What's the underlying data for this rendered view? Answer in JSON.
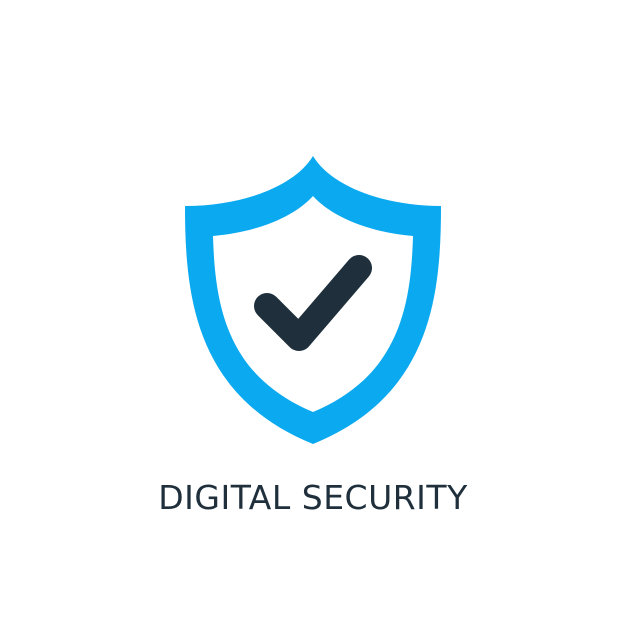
{
  "caption": {
    "text": "DIGITAL SECURITY"
  },
  "icon": {
    "name": "shield-check-icon",
    "shield_color": "#0aa9f0",
    "shield_inner_color": "#ffffff",
    "check_color": "#1f2f3b"
  },
  "colors": {
    "background": "#ffffff",
    "text": "#1f2f3b"
  }
}
